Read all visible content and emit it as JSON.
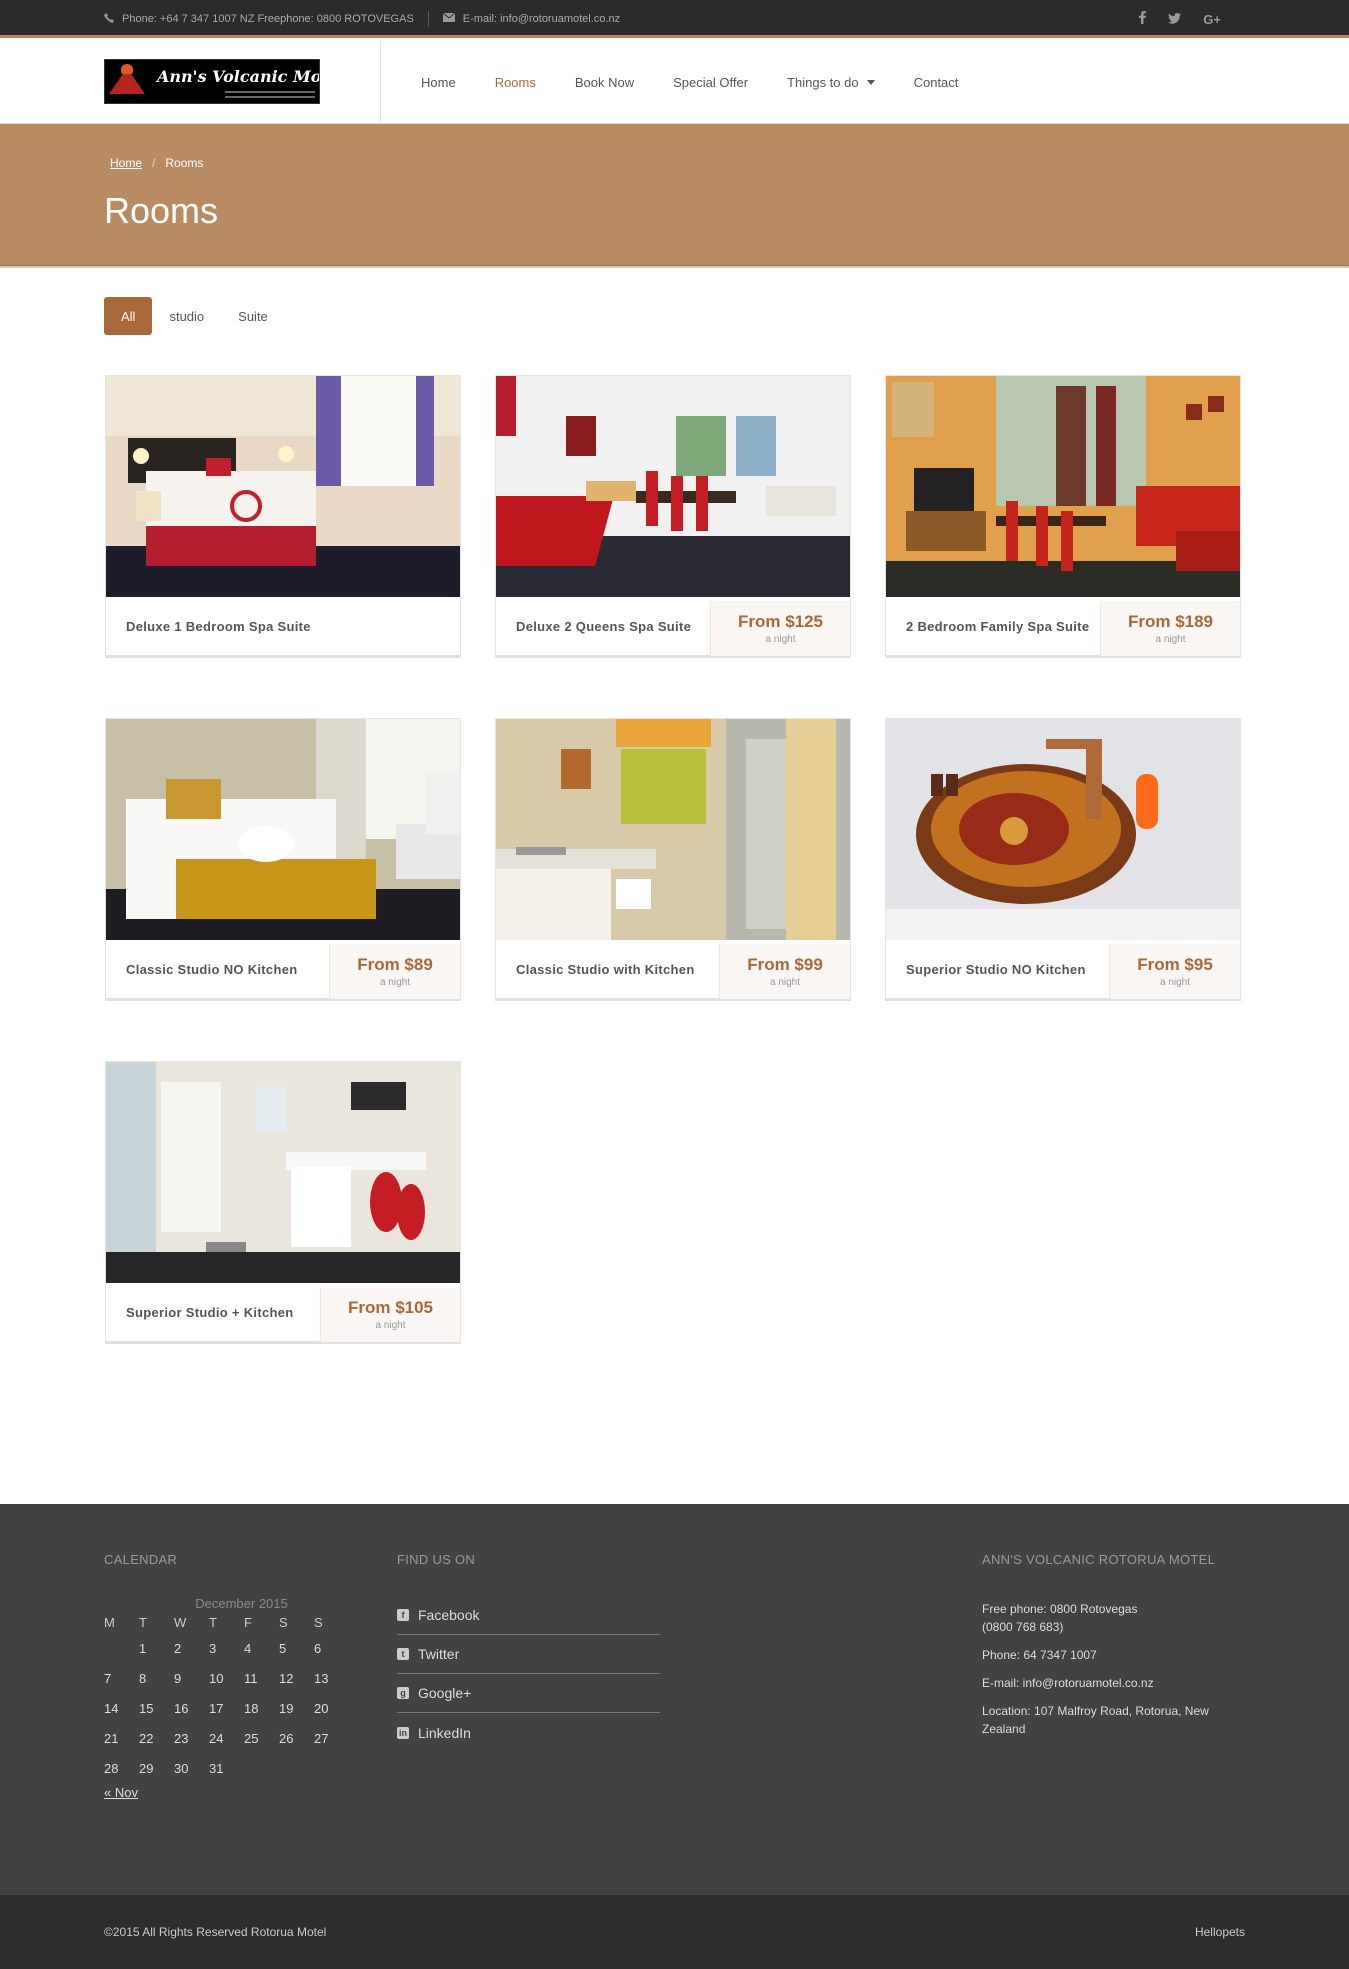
{
  "topbar": {
    "phone": "Phone: +64 7 347 1007 NZ Freephone: 0800 ROTOVEGAS",
    "email": "E-mail: info@rotoruamotel.co.nz",
    "social": [
      "facebook-icon",
      "twitter-icon",
      "google-plus-icon"
    ]
  },
  "logo": {
    "text": "Ann's Volcanic Motel"
  },
  "nav": [
    {
      "label": "Home"
    },
    {
      "label": "Rooms",
      "active": true
    },
    {
      "label": "Book Now"
    },
    {
      "label": "Special Offer"
    },
    {
      "label": "Things to do"
    },
    {
      "label": "Contact"
    }
  ],
  "breadcrumb": {
    "home": "Home",
    "current": "Rooms"
  },
  "page_title": "Rooms",
  "filters": [
    "All",
    "studio",
    "Suite"
  ],
  "rooms": [
    {
      "name": "Deluxe 1 Bedroom Spa Suite",
      "price": "",
      "per": ""
    },
    {
      "name": "Deluxe 2 Queens Spa Suite",
      "price": "From $125",
      "per": "a night"
    },
    {
      "name": "2 Bedroom Family Spa Suite",
      "price": "From $189",
      "per": "a night"
    },
    {
      "name": "Classic Studio NO Kitchen",
      "price": "From $89",
      "per": "a night"
    },
    {
      "name": "Classic Studio with Kitchen",
      "price": "From $99",
      "per": "a night"
    },
    {
      "name": "Superior Studio NO Kitchen",
      "price": "From $95",
      "per": "a night"
    },
    {
      "name": "Superior Studio + Kitchen",
      "price": "From $105",
      "per": "a night"
    }
  ],
  "footer": {
    "calendar_title": "CALENDAR",
    "calendar_month": "December 2015",
    "weekdays": [
      "M",
      "T",
      "W",
      "T",
      "F",
      "S",
      "S"
    ],
    "weeks": [
      [
        "",
        "1",
        "2",
        "3",
        "4",
        "5",
        "6"
      ],
      [
        "7",
        "8",
        "9",
        "10",
        "11",
        "12",
        "13"
      ],
      [
        "14",
        "15",
        "16",
        "17",
        "18",
        "19",
        "20"
      ],
      [
        "21",
        "22",
        "23",
        "24",
        "25",
        "26",
        "27"
      ],
      [
        "28",
        "29",
        "30",
        "31",
        "",
        "",
        ""
      ]
    ],
    "prev_link": "« Nov",
    "findus_title": "FIND US ON",
    "findus": [
      "Facebook",
      "Twitter",
      "Google+",
      "LinkedIn"
    ],
    "about_title": "ANN'S VOLCANIC ROTORUA MOTEL",
    "free_phone": "Free phone: 0800 Rotovegas",
    "free_phone_2": "(0800 768 683)",
    "phone": "Phone: 64 7347 1007",
    "email": "E-mail: info@rotoruamotel.co.nz",
    "location": "Location: 107 Malfroy Road, Rotorua, New Zealand",
    "copyright": "©2015 All Rights Reserved Rotorua Motel",
    "credit": "Hellopets"
  },
  "colors": {
    "accent": "#a8693a",
    "band": "#b88b63",
    "footer": "#424242",
    "topbar": "#2b2b2b"
  }
}
